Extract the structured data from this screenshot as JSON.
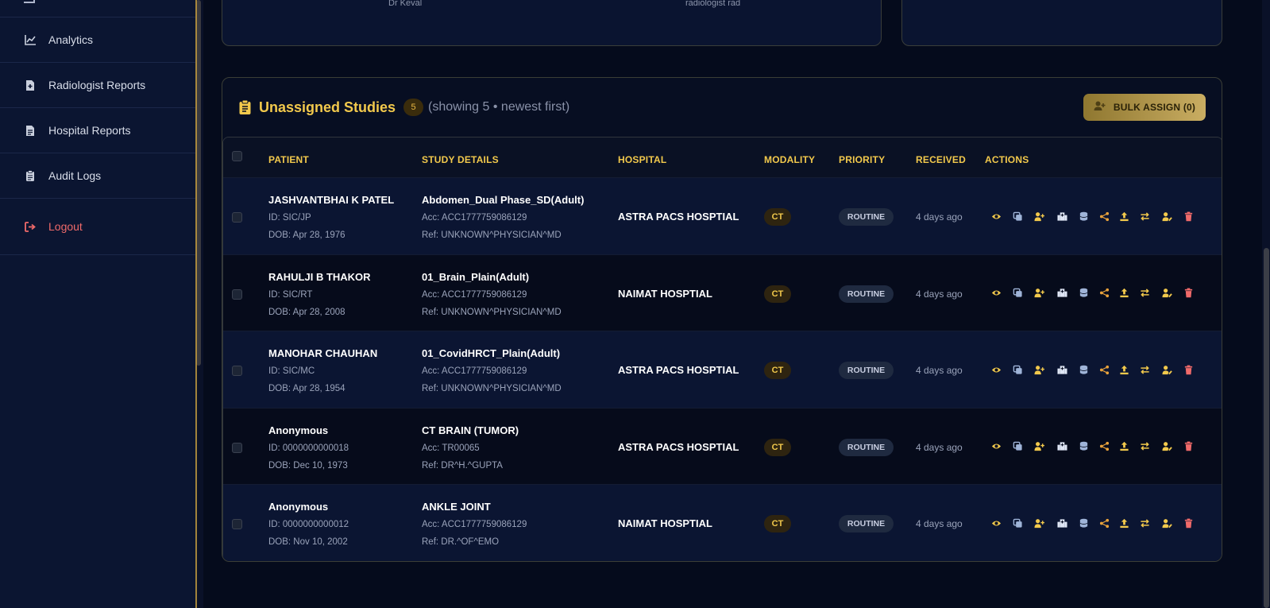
{
  "sidebar": {
    "items": [
      {
        "label": "Analytics",
        "icon": "chart-line-icon"
      },
      {
        "label": "Radiologist Reports",
        "icon": "file-medical-icon"
      },
      {
        "label": "Hospital Reports",
        "icon": "file-text-icon"
      },
      {
        "label": "Audit Logs",
        "icon": "clipboard-icon"
      }
    ],
    "logout": {
      "label": "Logout",
      "icon": "logout-icon"
    }
  },
  "top_cards": {
    "left_name_1": "Dr Keval",
    "left_name_2": "radiologist rad"
  },
  "panel": {
    "title": "Unassigned Studies",
    "count": "5",
    "subtitle": "(showing 5 • newest first)",
    "bulk_assign_label": "BULK ASSIGN (0)"
  },
  "table": {
    "headers": {
      "patient": "PATIENT",
      "study": "STUDY DETAILS",
      "hospital": "HOSPITAL",
      "modality": "MODALITY",
      "priority": "PRIORITY",
      "received": "RECEIVED",
      "actions": "ACTIONS"
    },
    "rows": [
      {
        "name": "JASHVANTBHAI K PATEL",
        "id": "ID: SIC/JP",
        "dob": "DOB: Apr 28, 1976",
        "study": "Abdomen_Dual Phase_SD(Adult)",
        "acc": "Acc: ACC1777759086129",
        "ref": "Ref: UNKNOWN^PHYSICIAN^MD",
        "hospital": "ASTRA PACS HOSPTIAL",
        "modality": "CT",
        "priority": "ROUTINE",
        "received": "4 days ago"
      },
      {
        "name": "RAHULJI B THAKOR",
        "id": "ID: SIC/RT",
        "dob": "DOB: Apr 28, 2008",
        "study": "01_Brain_Plain(Adult)",
        "acc": "Acc: ACC1777759086129",
        "ref": "Ref: UNKNOWN^PHYSICIAN^MD",
        "hospital": "NAIMAT HOSPTIAL",
        "modality": "CT",
        "priority": "ROUTINE",
        "received": "4 days ago"
      },
      {
        "name": "MANOHAR CHAUHAN",
        "id": "ID: SIC/MC",
        "dob": "DOB: Apr 28, 1954",
        "study": "01_CovidHRCT_Plain(Adult)",
        "acc": "Acc: ACC1777759086129",
        "ref": "Ref: UNKNOWN^PHYSICIAN^MD",
        "hospital": "ASTRA PACS HOSPTIAL",
        "modality": "CT",
        "priority": "ROUTINE",
        "received": "4 days ago"
      },
      {
        "name": "Anonymous",
        "id": "ID: 0000000000018",
        "dob": "DOB: Dec 10, 1973",
        "study": "CT BRAIN (TUMOR)",
        "acc": "Acc: TR00065",
        "ref": "Ref: DR^H.^GUPTA",
        "hospital": "ASTRA PACS HOSPTIAL",
        "modality": "CT",
        "priority": "ROUTINE",
        "received": "4 days ago"
      },
      {
        "name": "Anonymous",
        "id": "ID: 0000000000012",
        "dob": "DOB: Nov 10, 2002",
        "study": "ANKLE JOINT",
        "acc": "Acc: ACC1777759086129",
        "ref": "Ref: DR.^OF^EMO",
        "hospital": "NAIMAT HOSPTIAL",
        "modality": "CT",
        "priority": "ROUTINE",
        "received": "4 days ago"
      }
    ]
  },
  "action_icons": [
    "eye-icon",
    "copy-icon",
    "assign-user-icon",
    "hospital-icon",
    "database-icon",
    "share-icon",
    "upload-icon",
    "transfer-icon",
    "user-edit-icon",
    "trash-icon"
  ],
  "colors": {
    "accent": "#f2c94c",
    "danger": "#f06a6a",
    "background": "#050b1c"
  }
}
